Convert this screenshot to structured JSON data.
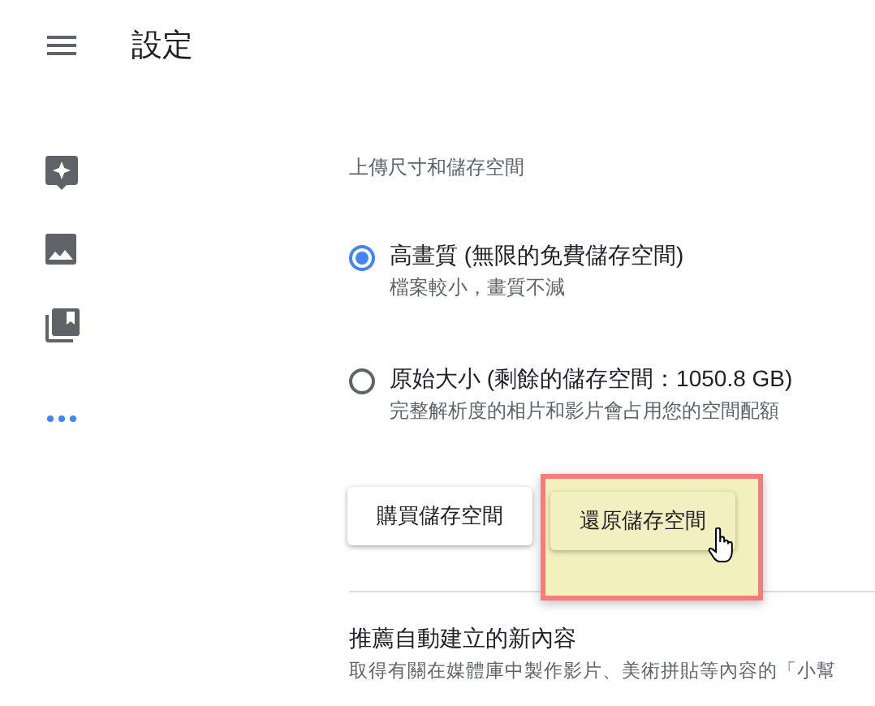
{
  "header": {
    "title": "設定"
  },
  "sidebar": {
    "items": [
      {
        "kind": "assistant"
      },
      {
        "kind": "photos"
      },
      {
        "kind": "albums"
      },
      {
        "kind": "more"
      }
    ]
  },
  "storage": {
    "label": "上傳尺寸和儲存空間",
    "options": [
      {
        "title": "高畫質 (無限的免費儲存空間)",
        "description": "檔案較小，畫質不減",
        "selected": true
      },
      {
        "title": "原始大小 (剩餘的儲存空間：1050.8 GB)",
        "description": "完整解析度的相片和影片會占用您的空間配額",
        "selected": false
      }
    ],
    "buttons": [
      {
        "label": "購買儲存空間",
        "highlighted": false
      },
      {
        "label": "還原儲存空間",
        "highlighted": true
      }
    ]
  },
  "suggestions": {
    "title": "推薦自動建立的新內容",
    "description": "取得有關在媒體庫中製作影片、美術拼貼等內容的「小幫"
  }
}
